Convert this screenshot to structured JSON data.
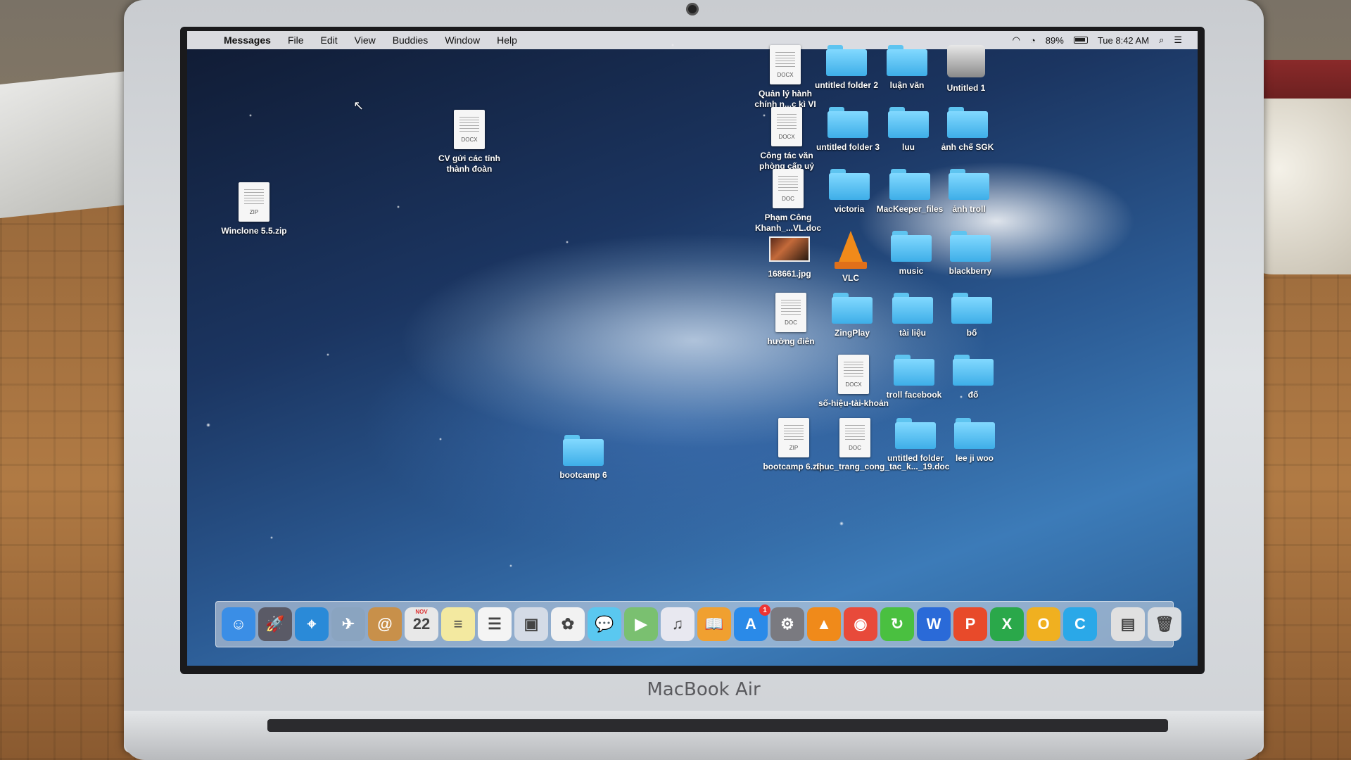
{
  "hardware": {
    "brand_label": "MacBook Air"
  },
  "menubar": {
    "apple_icon": "apple-icon",
    "app_name": "Messages",
    "items": [
      "File",
      "Edit",
      "View",
      "Buddies",
      "Window",
      "Help"
    ],
    "battery_percent": "89%",
    "clock": "Tue 8:42 AM"
  },
  "desktop": {
    "left_icons": [
      {
        "label": "Winclone 5.5.zip",
        "type": "zip",
        "badge": "ZIP"
      },
      {
        "label": "CV gửi các tỉnh thành đoàn",
        "type": "docx",
        "badge": "DOCX"
      },
      {
        "label": "bootcamp 6",
        "type": "folder"
      }
    ],
    "grid_icons": [
      {
        "label": "Quản lý hành chính n...c kì VI",
        "type": "docx",
        "badge": "DOCX"
      },
      {
        "label": "untitled folder 2",
        "type": "folder"
      },
      {
        "label": "luận văn",
        "type": "folder"
      },
      {
        "label": "Untitled 1",
        "type": "disk"
      },
      {
        "label": "Công tác văn phòng cấp uỷ",
        "type": "docx",
        "badge": "DOCX"
      },
      {
        "label": "untitled folder 3",
        "type": "folder"
      },
      {
        "label": "luu",
        "type": "folder"
      },
      {
        "label": "ảnh chế SGK",
        "type": "folder"
      },
      {
        "label": "Phạm Công Khanh_...VL.doc",
        "type": "doc",
        "badge": "DOC"
      },
      {
        "label": "victoria",
        "type": "folder"
      },
      {
        "label": "MacKeeper_files",
        "type": "folder"
      },
      {
        "label": "ảnh troll",
        "type": "folder"
      },
      {
        "label": "168661.jpg",
        "type": "image"
      },
      {
        "label": "VLC",
        "type": "vlc"
      },
      {
        "label": "music",
        "type": "folder"
      },
      {
        "label": "blackberry",
        "type": "folder"
      },
      {
        "label": "hường điên",
        "type": "doc",
        "badge": "DOC"
      },
      {
        "label": "ZingPlay",
        "type": "folder"
      },
      {
        "label": "tài liệu",
        "type": "folder"
      },
      {
        "label": "bố",
        "type": "folder"
      },
      {
        "label": "số-hiệu-tài-khoản",
        "type": "docx",
        "badge": "DOCX"
      },
      {
        "label": "troll facebook",
        "type": "folder"
      },
      {
        "label": "đố",
        "type": "folder"
      },
      {
        "label": "bootcamp 6.zip",
        "type": "zip",
        "badge": "ZIP"
      },
      {
        "label": "thuc_trang_cong_tac_k..._19.doc",
        "type": "doc",
        "badge": "DOC"
      },
      {
        "label": "untitled folder",
        "type": "folder"
      },
      {
        "label": "lee ji woo",
        "type": "folder"
      }
    ]
  },
  "dock": {
    "items": [
      {
        "name": "finder-icon",
        "glyph": "☺",
        "color": "#3a8ee6"
      },
      {
        "name": "launchpad-icon",
        "glyph": "🚀",
        "color": "#5a5a66"
      },
      {
        "name": "safari-icon",
        "glyph": "⌖",
        "color": "#2a8ad8"
      },
      {
        "name": "preview-icon",
        "glyph": "✈",
        "color": "#8aa4c0"
      },
      {
        "name": "contacts-icon",
        "glyph": "@",
        "color": "#c8904a"
      },
      {
        "name": "calendar-icon",
        "glyph": "22",
        "color": "#e8e8e8",
        "subtext": "NOV"
      },
      {
        "name": "notes-icon",
        "glyph": "≡",
        "color": "#f3e9a0"
      },
      {
        "name": "reminders-icon",
        "glyph": "☰",
        "color": "#f4f4f4"
      },
      {
        "name": "photo-booth-icon",
        "glyph": "▣",
        "color": "#d4dbe6"
      },
      {
        "name": "photos-icon",
        "glyph": "✿",
        "color": "#f2f2f2"
      },
      {
        "name": "messages-icon",
        "glyph": "💬",
        "color": "#5ac8f0"
      },
      {
        "name": "facetime-icon",
        "glyph": "▶",
        "color": "#7ac070"
      },
      {
        "name": "itunes-icon",
        "glyph": "♫",
        "color": "#e8e8f0"
      },
      {
        "name": "ibooks-icon",
        "glyph": "📖",
        "color": "#f0a030"
      },
      {
        "name": "app-store-icon",
        "glyph": "A",
        "color": "#2a8ae8",
        "badge": "1"
      },
      {
        "name": "system-preferences-icon",
        "glyph": "⚙",
        "color": "#7a7a80"
      },
      {
        "name": "vlc-icon",
        "glyph": "▲",
        "color": "#f08a1a"
      },
      {
        "name": "chrome-icon",
        "glyph": "◉",
        "color": "#e84a3a"
      },
      {
        "name": "refresh-app-icon",
        "glyph": "↻",
        "color": "#4ac040"
      },
      {
        "name": "word-icon",
        "glyph": "W",
        "color": "#2a6ad8"
      },
      {
        "name": "powerpoint-icon",
        "glyph": "P",
        "color": "#e84a2a"
      },
      {
        "name": "excel-icon",
        "glyph": "X",
        "color": "#2aa84a"
      },
      {
        "name": "outlook-icon",
        "glyph": "O",
        "color": "#f0b020"
      },
      {
        "name": "c-app-icon",
        "glyph": "C",
        "color": "#2aa8e8"
      },
      {
        "name": "documents-stack-icon",
        "glyph": "▤",
        "color": "#e0e0e0"
      },
      {
        "name": "trash-icon",
        "glyph": "🗑",
        "color": "#d8dce0"
      }
    ]
  }
}
